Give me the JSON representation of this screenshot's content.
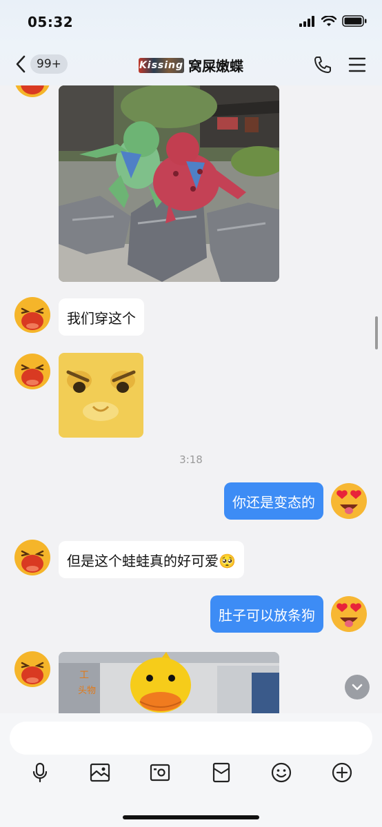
{
  "status_bar": {
    "time": "05:32"
  },
  "nav": {
    "back_badge": "99+",
    "logo_text": "Kissing",
    "title": "窝屎嫩蝶"
  },
  "messages": {
    "m1": "我们穿这个",
    "timestamp": "3:18",
    "m2": "你还是变态的",
    "m3": "但是这个蛙蛙真的好可爱🥺",
    "m4": "肚子可以放条狗"
  },
  "photo_sign": "工\n头物",
  "colors": {
    "accent": "#3d8cf5",
    "background": "#f2f2f4"
  },
  "icons": [
    "back-chevron-icon",
    "phone-icon",
    "menu-icon",
    "microphone-icon",
    "image-icon",
    "camera-icon",
    "red-packet-icon",
    "emoji-icon",
    "plus-icon",
    "scroll-down-icon"
  ]
}
